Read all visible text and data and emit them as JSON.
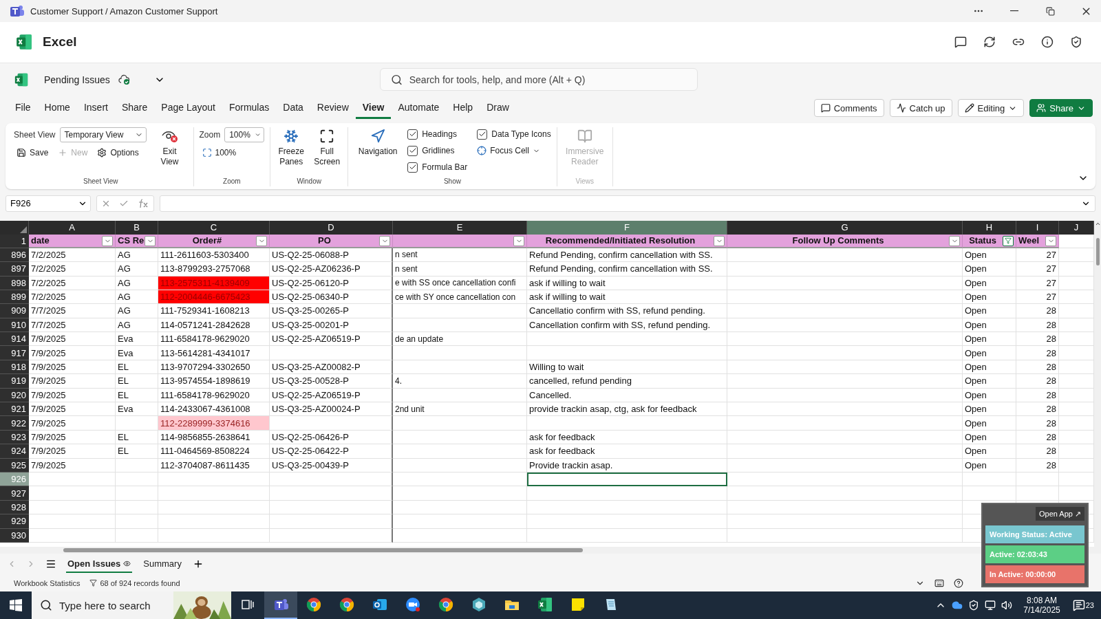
{
  "window": {
    "title": "Customer Support / Amazon Customer Support"
  },
  "app": {
    "name": "Excel"
  },
  "file": {
    "name": "Pending Issues"
  },
  "search": {
    "placeholder": "Search for tools, help, and more (Alt + Q)"
  },
  "menu_tabs": [
    {
      "label": "File",
      "selected": false
    },
    {
      "label": "Home",
      "selected": false
    },
    {
      "label": "Insert",
      "selected": false
    },
    {
      "label": "Share",
      "selected": false
    },
    {
      "label": "Page Layout",
      "selected": false
    },
    {
      "label": "Formulas",
      "selected": false
    },
    {
      "label": "Data",
      "selected": false
    },
    {
      "label": "Review",
      "selected": false
    },
    {
      "label": "View",
      "selected": true
    },
    {
      "label": "Automate",
      "selected": false
    },
    {
      "label": "Help",
      "selected": false
    },
    {
      "label": "Draw",
      "selected": false
    }
  ],
  "actions": [
    {
      "label": "Comments",
      "kind": "comments"
    },
    {
      "label": "Catch up",
      "kind": "catchup"
    },
    {
      "label": "Editing",
      "kind": "editing"
    },
    {
      "label": "Share",
      "kind": "share"
    }
  ],
  "ribbon": {
    "sheet_view": {
      "title": "Sheet View",
      "label": "Sheet View",
      "view": "Temporary View",
      "save": "Save",
      "new": {
        "label": "New",
        "disabled": true
      },
      "options": "Options",
      "exit": "Exit View"
    },
    "zoom": {
      "title": "Zoom",
      "label": "Zoom",
      "value": "100%",
      "reset": "100%"
    },
    "window": {
      "title": "Window",
      "freeze": "Freeze Panes",
      "full": "Full Screen"
    },
    "show": {
      "title": "Show",
      "navigation": "Navigation",
      "checks": [
        {
          "label": "Headings",
          "checked": true
        },
        {
          "label": "Gridlines",
          "checked": true
        },
        {
          "label": "Formula Bar",
          "checked": true
        },
        {
          "label": "Data Type Icons",
          "checked": true
        }
      ],
      "focus": "Focus Cell"
    },
    "views": {
      "title": "Views",
      "reader": {
        "label": "Immersive Reader",
        "disabled": true
      }
    }
  },
  "formula_bar": {
    "name_box": "F926"
  },
  "sheet": {
    "columns": [
      {
        "letter": "A",
        "header": "date",
        "selected": false,
        "filtered": false
      },
      {
        "letter": "B",
        "header": "CS Re",
        "selected": false,
        "filtered": false
      },
      {
        "letter": "C",
        "header": "Order#",
        "selected": false,
        "filtered": false
      },
      {
        "letter": "D",
        "header": "PO",
        "selected": false,
        "filtered": false
      },
      {
        "letter": "E",
        "selected": false,
        "filtered": false
      },
      {
        "letter": "F",
        "header": "Recommended/Initiated Resolution",
        "selected": true,
        "filtered": false
      },
      {
        "letter": "G",
        "header": "Follow Up Comments",
        "selected": false,
        "filtered": false
      },
      {
        "letter": "H",
        "header": "Status",
        "selected": false,
        "filtered": true
      },
      {
        "letter": "I",
        "header": "Weel",
        "selected": false,
        "filtered": false
      },
      {
        "letter": "J",
        "selected": false
      }
    ],
    "header_row": "1",
    "rows": [
      {
        "row": "896",
        "date": "7/2/2025",
        "rep": "AG",
        "order": "111-2611603-5303400",
        "po": "US-Q2-25-06088-P",
        "e": "n sent",
        "f": "Refund Pending, confirm cancellation with SS.",
        "status": "Open",
        "week": "27"
      },
      {
        "row": "897",
        "date": "7/2/2025",
        "rep": "AG",
        "order": "113-8799293-2757068",
        "po": "US-Q2-25-AZ06236-P",
        "e": "n sent",
        "f": "Refund Pending, confirm cancellation with SS.",
        "status": "Open",
        "week": "27"
      },
      {
        "row": "898",
        "date": "7/2/2025",
        "rep": "AG",
        "order": "113-2575311-4139409",
        "color": "#ff0000",
        "po": "US-Q2-25-06120-P",
        "e": "e with SS once cancellation confi",
        "f": "ask if willing to wait",
        "status": "Open",
        "week": "27"
      },
      {
        "row": "899",
        "date": "7/2/2025",
        "rep": "AG",
        "order": "112-2004446-6675423",
        "color": "#ff0000",
        "po": "US-Q2-25-06340-P",
        "e": "ce with SY once cancellation con",
        "f": "ask if willing to wait",
        "status": "Open",
        "week": "27"
      },
      {
        "row": "909",
        "date": "7/7/2025",
        "rep": "AG",
        "order": "111-7529341-1608213",
        "po": "US-Q3-25-00265-P",
        "f": "Cancellatio confirm with SS, refund pending.",
        "status": "Open",
        "week": "28"
      },
      {
        "row": "910",
        "date": "7/7/2025",
        "rep": "AG",
        "order": "114-0571241-2842628",
        "po": "US-Q3-25-00201-P",
        "f": "Cancellation confirm with SS, refund pending.",
        "status": "Open",
        "week": "28"
      },
      {
        "row": "914",
        "date": "7/9/2025",
        "rep": "Eva",
        "order": "111-6584178-9629020",
        "po": "US-Q2-25-AZ06519-P",
        "e": "de an update",
        "status": "Open",
        "week": "28"
      },
      {
        "row": "917",
        "date": "7/9/2025",
        "rep": "Eva",
        "order": "113-5614281-4341017",
        "status": "Open",
        "week": "28"
      },
      {
        "row": "918",
        "date": "7/9/2025",
        "rep": "EL",
        "order": "113-9707294-3302650",
        "po": "US-Q3-25-AZ00082-P",
        "f": "Willing to wait",
        "status": "Open",
        "week": "28"
      },
      {
        "row": "919",
        "date": "7/9/2025",
        "rep": "EL",
        "order": "113-9574554-1898619",
        "po": "US-Q3-25-00528-P",
        "e": "4.",
        "f": "cancelled, refund pending",
        "status": "Open",
        "week": "28"
      },
      {
        "row": "920",
        "date": "7/9/2025",
        "rep": "EL",
        "order": "111-6584178-9629020",
        "po": "US-Q2-25-AZ06519-P",
        "f": "Cancelled.",
        "status": "Open",
        "week": "28"
      },
      {
        "row": "921",
        "date": "7/9/2025",
        "rep": "Eva",
        "order": "114-2433067-4361008",
        "po": "US-Q3-25-AZ00024-P",
        "e": "2nd unit",
        "f": "provide trackin asap, ctg, ask for feedback",
        "status": "Open",
        "week": "28"
      },
      {
        "row": "922",
        "date": "7/9/2025",
        "order": "112-2289999-3374616",
        "color": "#ffc7ce",
        "status": "Open",
        "week": "28"
      },
      {
        "row": "923",
        "date": "7/9/2025",
        "rep": "EL",
        "order": "114-9856855-2638641",
        "po": "US-Q2-25-06426-P",
        "f": "ask for feedback",
        "status": "Open",
        "week": "28"
      },
      {
        "row": "924",
        "date": "7/9/2025",
        "rep": "EL",
        "order": "111-0464569-8508224",
        "po": "US-Q2-25-06422-P",
        "f": "ask for feedback",
        "status": "Open",
        "week": "28"
      },
      {
        "row": "925",
        "date": "7/9/2025",
        "order": "112-3704087-8611435",
        "po": "US-Q3-25-00439-P",
        "f": "Provide trackin asap.",
        "status": "Open",
        "week": "28"
      }
    ],
    "empty_rows": [
      {
        "row": "926",
        "selected": true
      },
      {
        "row": "927",
        "selected": false
      },
      {
        "row": "928",
        "selected": false
      },
      {
        "row": "929",
        "selected": false
      },
      {
        "row": "930",
        "selected": false
      }
    ]
  },
  "widget": {
    "open": "Open App ↗",
    "status": "Working Status: Active",
    "active": "Active: 02:03:43",
    "inactive": "In Active: 00:00:00"
  },
  "sheet_tabs": [
    {
      "label": "Open Issues",
      "selected": true
    },
    {
      "label": "Summary",
      "selected": false
    }
  ],
  "status_bar": {
    "stats": "Workbook Statistics",
    "records": "68 of 924 records found"
  },
  "taskbar": {
    "search_placeholder": "Type here to search",
    "time": "8:08 AM",
    "date": "7/14/2025",
    "notifications": "23",
    "apps": [
      {
        "kind": "teams",
        "selected": true
      },
      {
        "kind": "chrome",
        "selected": false
      },
      {
        "kind": "chrome",
        "selected": false
      },
      {
        "kind": "outlook",
        "selected": false
      },
      {
        "kind": "zoom",
        "selected": false
      },
      {
        "kind": "chrome",
        "selected": false
      },
      {
        "kind": "cube",
        "selected": false
      },
      {
        "kind": "folder",
        "selected": false
      },
      {
        "kind": "excel",
        "selected": false
      },
      {
        "kind": "notes",
        "selected": false
      },
      {
        "kind": "notepad",
        "selected": false
      }
    ]
  }
}
